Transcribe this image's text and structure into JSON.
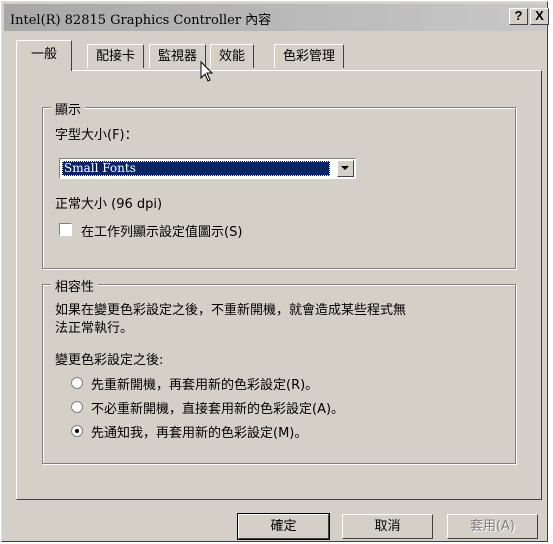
{
  "window": {
    "title": "Intel(R) 82815 Graphics Controller 內容",
    "help_glyph": "?",
    "close_glyph": "X"
  },
  "tabs": [
    {
      "label": "一般",
      "active": true
    },
    {
      "label": "配接卡",
      "active": false
    },
    {
      "label": "監視器",
      "active": false
    },
    {
      "label": "效能",
      "active": false
    },
    {
      "label": "色彩管理",
      "active": false
    }
  ],
  "display_group": {
    "title": "顯示",
    "font_size_label": "字型大小(F)：",
    "font_size_value": "Small Fonts",
    "dpi_text": "正常大小 (96 dpi)",
    "taskbar_checkbox_label": "在工作列顯示設定值圖示(S)",
    "taskbar_checkbox_checked": false
  },
  "compat_group": {
    "title": "相容性",
    "description_line1": "如果在變更色彩設定之後，不重新開機，就會造成某些程式無",
    "description_line2": "法正常執行。",
    "after_change_label": "變更色彩設定之後:",
    "options": [
      {
        "label": "先重新開機，再套用新的色彩設定(R)。",
        "checked": false
      },
      {
        "label": "不必重新開機，直接套用新的色彩設定(A)。",
        "checked": false
      },
      {
        "label": "先通知我，再套用新的色彩設定(M)。",
        "checked": true
      }
    ]
  },
  "buttons": {
    "ok": "確定",
    "cancel": "取消",
    "apply": "套用(A)"
  },
  "icons": {
    "mouse_cursor": "arrow-cursor-icon",
    "dropdown": "chevron-down-icon"
  }
}
